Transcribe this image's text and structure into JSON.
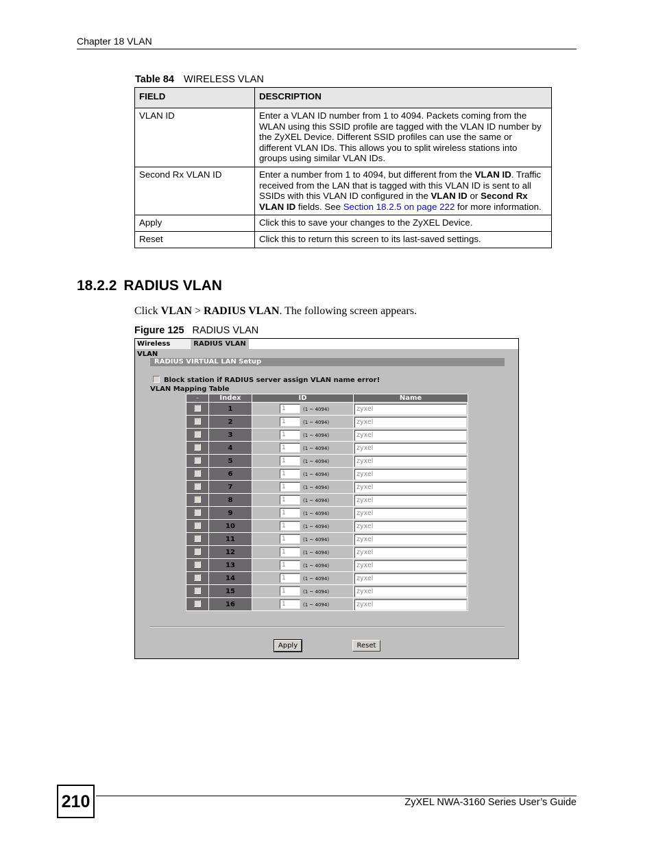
{
  "header": {
    "chapter": "Chapter 18 VLAN"
  },
  "table": {
    "caption_label": "Table 84",
    "caption_title": "WIRELESS VLAN",
    "columns": [
      "FIELD",
      "DESCRIPTION"
    ],
    "rows": [
      {
        "field": "VLAN ID",
        "description": "Enter a VLAN ID number from 1 to 4094. Packets coming from the WLAN using this SSID profile are tagged with the VLAN ID number by the ZyXEL Device. Different SSID profiles can use the same or different VLAN IDs. This allows you to split wireless stations into groups using similar VLAN IDs."
      },
      {
        "field": "Second Rx VLAN ID",
        "desc_parts": {
          "p1": "Enter a number from 1 to 4094, but different from the ",
          "b1": "VLAN ID",
          "p2": ". Traffic received from the LAN that is tagged with this VLAN ID is sent to all SSIDs with this VLAN ID configured in the ",
          "b2": "VLAN ID",
          "p3": " or ",
          "b3": "Second Rx VLAN ID",
          "p4": " fields. See ",
          "link": "Section 18.2.5 on page 222",
          "p5": " for more information."
        }
      },
      {
        "field": "Apply",
        "description": "Click this to save your changes to the ZyXEL Device."
      },
      {
        "field": "Reset",
        "description": "Click this to return this screen to its last-saved settings."
      }
    ]
  },
  "section": {
    "number": "18.2.2",
    "title": "RADIUS VLAN",
    "intro": {
      "p1": "Click ",
      "b1": "VLAN",
      "p2": " > ",
      "b2": "RADIUS VLAN",
      "p3": ". The following screen appears."
    }
  },
  "figure": {
    "caption_label": "Figure 125",
    "caption_title": "RADIUS VLAN",
    "tabs": [
      "Wireless VLAN",
      "RADIUS VLAN"
    ],
    "active_tab": "RADIUS VLAN",
    "setup_title": "RADIUS VIRTUAL LAN Setup",
    "block_checkbox_label": "Block station if RADIUS server assign VLAN name error!",
    "block_checked": false,
    "mapping_title": "VLAN Mapping Table",
    "columns": [
      "-",
      "Index",
      "ID",
      "Name"
    ],
    "range_hint": "(1 ~ 4094)",
    "rows": [
      {
        "index": "1",
        "id": "1",
        "name": "zyxel",
        "checked": false
      },
      {
        "index": "2",
        "id": "1",
        "name": "zyxel",
        "checked": false
      },
      {
        "index": "3",
        "id": "1",
        "name": "zyxel",
        "checked": false
      },
      {
        "index": "4",
        "id": "1",
        "name": "zyxel",
        "checked": false
      },
      {
        "index": "5",
        "id": "1",
        "name": "zyxel",
        "checked": false
      },
      {
        "index": "6",
        "id": "1",
        "name": "zyxel",
        "checked": false
      },
      {
        "index": "7",
        "id": "1",
        "name": "zyxel",
        "checked": false
      },
      {
        "index": "8",
        "id": "1",
        "name": "zyxel",
        "checked": false
      },
      {
        "index": "9",
        "id": "1",
        "name": "zyxel",
        "checked": false
      },
      {
        "index": "10",
        "id": "1",
        "name": "zyxel",
        "checked": false
      },
      {
        "index": "11",
        "id": "1",
        "name": "zyxel",
        "checked": false
      },
      {
        "index": "12",
        "id": "1",
        "name": "zyxel",
        "checked": false
      },
      {
        "index": "13",
        "id": "1",
        "name": "zyxel",
        "checked": false
      },
      {
        "index": "14",
        "id": "1",
        "name": "zyxel",
        "checked": false
      },
      {
        "index": "15",
        "id": "1",
        "name": "zyxel",
        "checked": false
      },
      {
        "index": "16",
        "id": "1",
        "name": "zyxel",
        "checked": false
      }
    ],
    "apply_label": "Apply",
    "reset_label": "Reset"
  },
  "footer": {
    "page_number": "210",
    "guide_title": "ZyXEL NWA-3160 Series User’s Guide"
  },
  "colors": {
    "link": "#0000ff",
    "table_header_bg": "#e6e6e6",
    "figure_bg": "#c0bfc0",
    "grid_header_bg": "#6a686a",
    "setup_bar_bg": "#8e8d8e"
  }
}
